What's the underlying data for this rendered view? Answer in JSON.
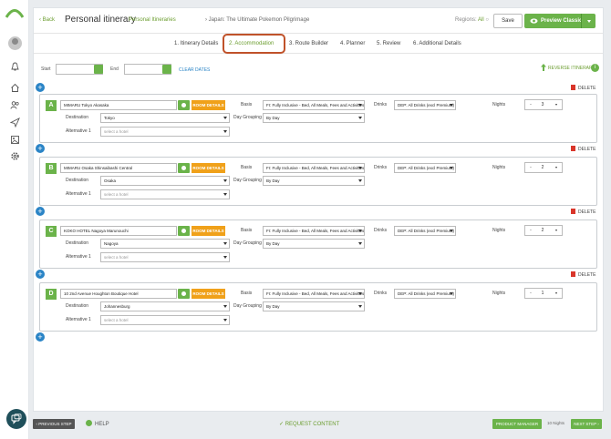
{
  "header": {
    "back_label": "Back",
    "title": "Personal itinerary",
    "breadcrumb_link": "Personal Itineraries",
    "breadcrumb_current": "Japan: The Ultimate Pokemon Pilgrimage",
    "regions_label": "Regions:",
    "regions_value": "All",
    "save_label": "Save",
    "preview_label": "Preview Classic"
  },
  "tabs": [
    {
      "label": "1. Itinerary Details"
    },
    {
      "label": "2. Accommodation",
      "active": true
    },
    {
      "label": "3. Route Builder"
    },
    {
      "label": "4. Planner"
    },
    {
      "label": "5. Review"
    },
    {
      "label": "6. Additional Details"
    }
  ],
  "dates": {
    "start_label": "Start",
    "end_label": "End",
    "start_value": "",
    "end_value": "",
    "clear_label": "CLEAR DATES",
    "reverse_label": "REVERSE ITINERARY"
  },
  "labels": {
    "delete": "DELETE",
    "room_details": "ROOM DETAILS",
    "destination": "Destination",
    "alternative": "Alternative 1",
    "basis": "Basis",
    "day_grouping": "Day Grouping",
    "drinks": "Drinks",
    "nights": "Nights",
    "select_hotel_placeholder": "select a hotel"
  },
  "stops": [
    {
      "letter": "A",
      "hotel": "MIMARU Tokyo Akasaka",
      "destination": "Tokyo",
      "basis": "FI: Fully Inclusive - Bed, All Meals, Fees and Activities",
      "day_grouping": "By Day",
      "drinks": "DEP: All Drinks (excl Premium)",
      "nights": "3"
    },
    {
      "letter": "B",
      "hotel": "MIMARU Osaka Shinsaibashi Central",
      "destination": "Osaka",
      "basis": "FI: Fully Inclusive - Bed, All Meals, Fees and Activities",
      "day_grouping": "By Day",
      "drinks": "DEP: All Drinks (excl Premium)",
      "nights": "2"
    },
    {
      "letter": "C",
      "hotel": "KOKO HOTEL Nagoya Marunouchi",
      "destination": "Nagoya",
      "basis": "FI: Fully Inclusive - Bed, All Meals, Fees and Activities",
      "day_grouping": "By Day",
      "drinks": "DEP: All Drinks (excl Premium)",
      "nights": "2"
    },
    {
      "letter": "D",
      "hotel": "10 2nd Avenue Houghton Boutique Hotel",
      "destination": "Johannesburg",
      "basis": "FI: Fully Inclusive - Bed, All Meals, Fees and Activities",
      "day_grouping": "By Day",
      "drinks": "DEP: All Drinks (excl Premium)",
      "nights": "1"
    }
  ],
  "footer": {
    "prev_label": "PREVIOUS STEP",
    "help_label": "HELP",
    "request_label": "REQUEST CONTENT",
    "pm_label": "PRODUCT MANAGER",
    "nights_total": "10 Nights",
    "next_label": "NEXT STEP"
  },
  "colors": {
    "accent": "#6bb34a",
    "link": "#2a84c6",
    "warning": "#f0a11a",
    "danger": "#d9362b",
    "highlight": "#c0522a"
  },
  "icons": {
    "logo": "arch-logo",
    "bell": "bell-icon",
    "users": "users-icon",
    "home": "home-icon",
    "send": "send-icon",
    "image": "image-icon",
    "settings": "gear-icon",
    "chat": "chat-icon"
  }
}
